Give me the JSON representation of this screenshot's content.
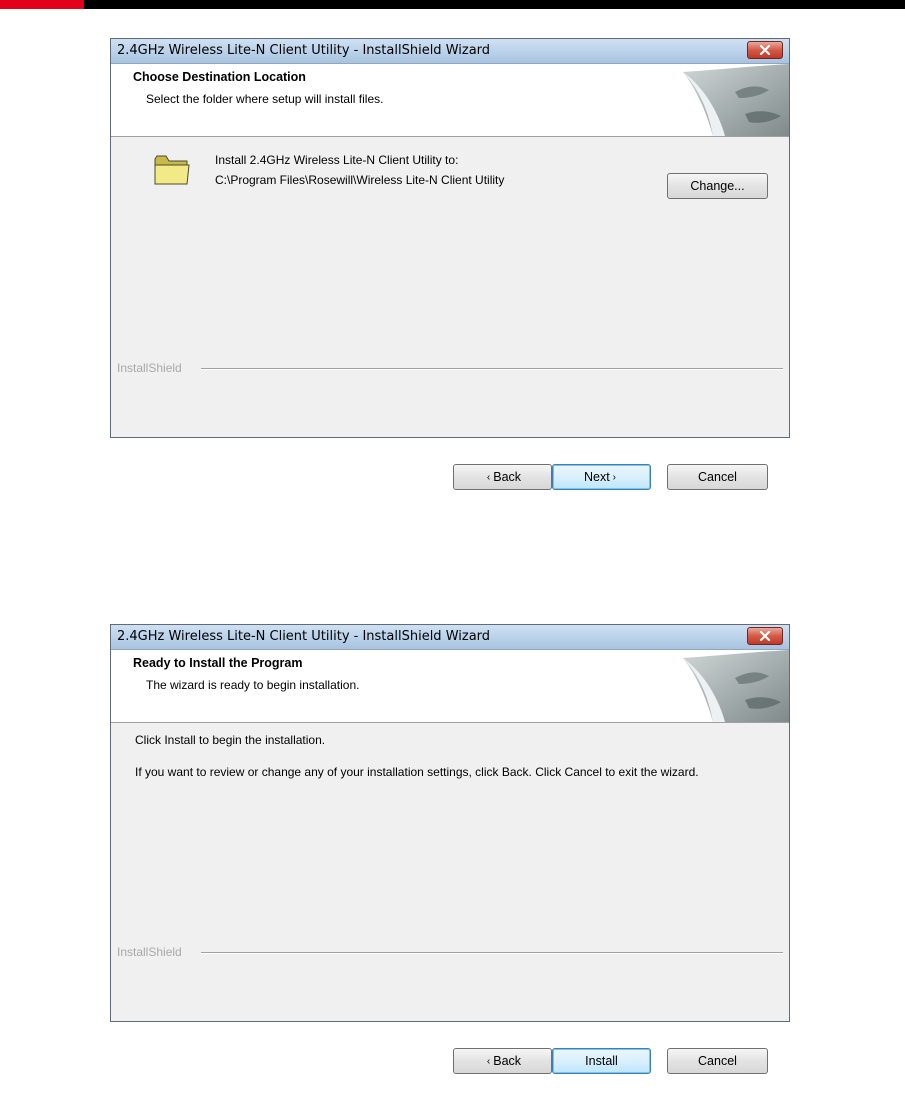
{
  "dialog1": {
    "title": "2.4GHz Wireless Lite-N Client Utility - InstallShield Wizard",
    "heading": "Choose Destination Location",
    "subheading": "Select the folder where setup will install files.",
    "install_label": "Install 2.4GHz Wireless Lite-N Client Utility to:",
    "path": "C:\\Program Files\\Rosewill\\Wireless Lite-N Client Utility",
    "change_label": "Change...",
    "brand": "InstallShield",
    "back_label": "Back",
    "next_label": "Next",
    "cancel_label": "Cancel",
    "icons": {
      "folder": "folder-icon",
      "close": "close-icon"
    }
  },
  "dialog2": {
    "title": "2.4GHz Wireless Lite-N Client Utility - InstallShield Wizard",
    "heading": "Ready to Install the Program",
    "subheading": "The wizard is ready to begin installation.",
    "line1": "Click Install to begin the installation.",
    "line2": "If you want to review or change any of your installation settings, click Back. Click Cancel to exit the wizard.",
    "brand": "InstallShield",
    "back_label": "Back",
    "install_label": "Install",
    "cancel_label": "Cancel"
  },
  "colors": {
    "accent_red": "#e3001b",
    "dialog_face": "#f0f0f0",
    "titlebar": "#b9d1ea",
    "close_red": "#c0392b"
  }
}
